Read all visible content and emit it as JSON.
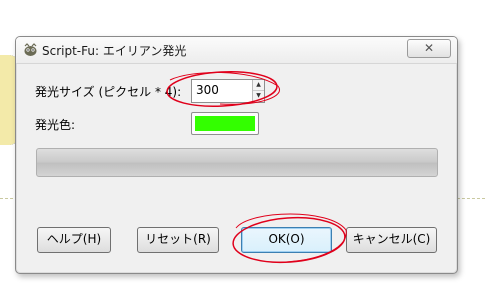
{
  "window": {
    "title": "Script-Fu: エイリアン発光",
    "close_label": "✕"
  },
  "form": {
    "glow_size_label": "発光サイズ (ピクセル * 4):",
    "glow_size_value": "300",
    "glow_color_label": "発光色:",
    "glow_color": "#33ff00"
  },
  "buttons": {
    "help": "ヘルプ(H)",
    "reset": "リセット(R)",
    "ok": "OK(O)",
    "cancel": "キャンセル(C)"
  },
  "annotation_color": "#e0001b"
}
